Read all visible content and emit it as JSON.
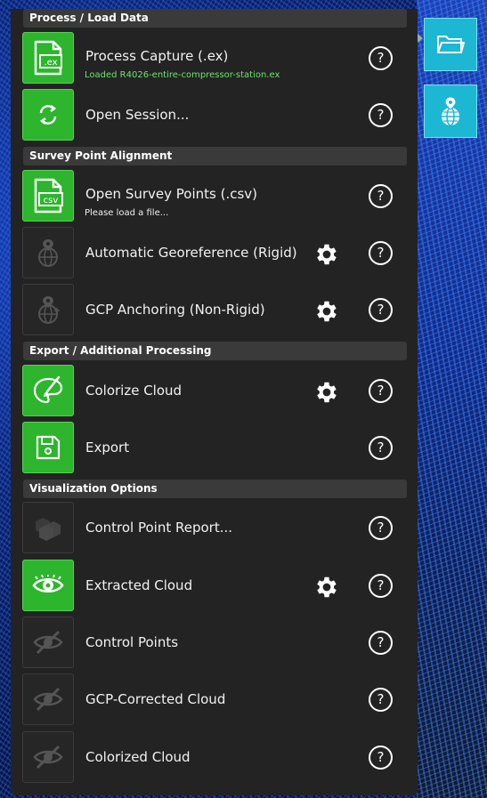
{
  "colors": {
    "panel": "#232323",
    "header": "#3a3a3a",
    "active_green": "#2db52d",
    "side_button": "#1cb8d3",
    "loaded_text_green": "#6fe36f"
  },
  "sections": [
    {
      "title": "Process / Load Data",
      "items": [
        {
          "label": "Process Capture (.ex)",
          "subtext": "Loaded R4026-entire-compressor-station.ex",
          "icon": "ex-file-icon",
          "active": true,
          "gear": false,
          "help": "?"
        },
        {
          "label": "Open Session...",
          "icon": "refresh-icon",
          "active": true,
          "gear": false,
          "help": "?"
        }
      ]
    },
    {
      "title": "Survey Point Alignment",
      "items": [
        {
          "label": "Open Survey Points (.csv)",
          "subtext": "Please load a file...",
          "icon": "csv-file-icon",
          "active": true,
          "gear": false,
          "help": "?"
        },
        {
          "label": "Automatic Georeference (Rigid)",
          "icon": "globe-pin-icon",
          "active": false,
          "gear": true,
          "help": "?"
        },
        {
          "label": "GCP Anchoring (Non-Rigid)",
          "icon": "globe-pin-sparkle-icon",
          "active": false,
          "gear": true,
          "help": "?"
        }
      ]
    },
    {
      "title": "Export / Additional Processing",
      "items": [
        {
          "label": "Colorize Cloud",
          "icon": "paint-palette-icon",
          "active": true,
          "gear": true,
          "help": "?"
        },
        {
          "label": "Export",
          "icon": "save-icon",
          "active": true,
          "gear": false,
          "help": "?"
        }
      ]
    },
    {
      "title": "Visualization Options",
      "items": [
        {
          "label": "Control Point Report...",
          "icon": "report-cubes-icon",
          "active": false,
          "gear": false,
          "help": "?"
        },
        {
          "label": "Extracted Cloud",
          "icon": "eye-icon",
          "active": true,
          "gear": true,
          "help": "?"
        },
        {
          "label": "Control Points",
          "icon": "eye-off-icon",
          "active": false,
          "gear": false,
          "help": "?"
        },
        {
          "label": "GCP-Corrected Cloud",
          "icon": "eye-off-icon",
          "active": false,
          "gear": false,
          "help": "?"
        },
        {
          "label": "Colorized Cloud",
          "icon": "eye-off-icon",
          "active": false,
          "gear": false,
          "help": "?"
        }
      ]
    }
  ],
  "side_buttons": [
    {
      "icon": "folder-icon"
    },
    {
      "icon": "globe-pin-icon"
    }
  ]
}
